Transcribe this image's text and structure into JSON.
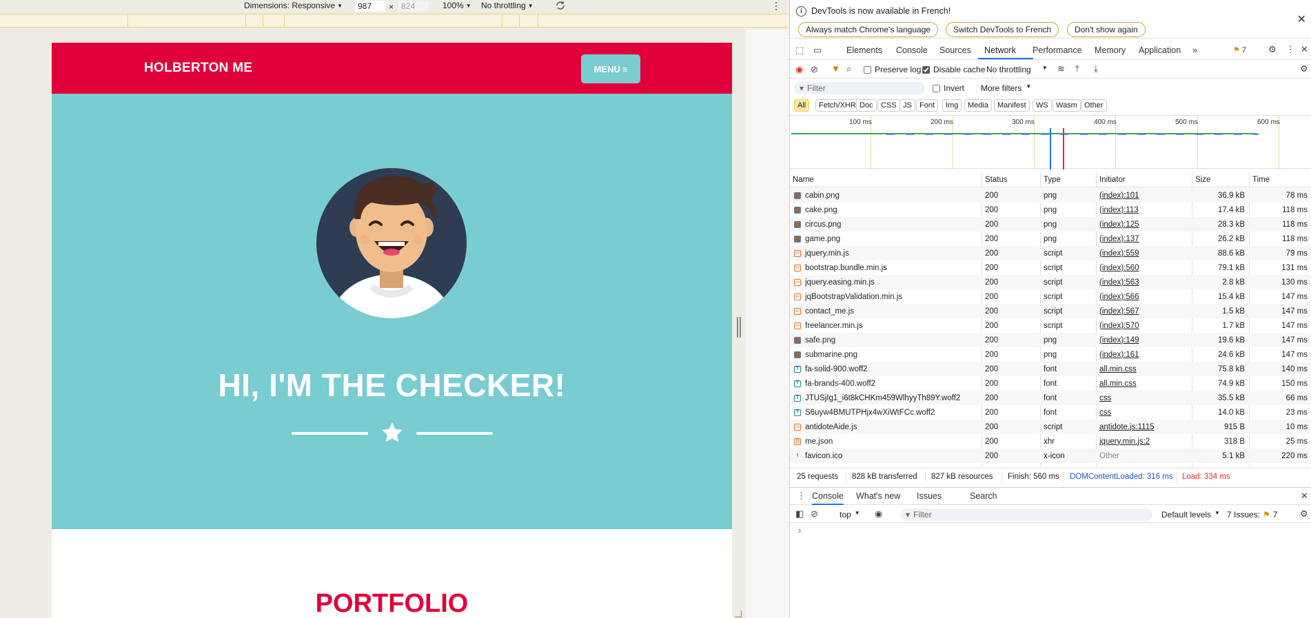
{
  "emulation_toolbar": {
    "dimensions_label": "Dimensions: Responsive",
    "width_value": "987",
    "times": "×",
    "height_value": "824",
    "zoom": "100%",
    "throttling": "No throttling"
  },
  "site": {
    "brand": "HOLBERTON ME",
    "menu_label": "MENU",
    "hero_title": "HI, I'M THE CHECKER!",
    "portfolio_title": "PORTFOLIO",
    "colors": {
      "primary": "#e2003b",
      "hero": "#79ccd0"
    }
  },
  "devtools": {
    "infobar": {
      "message": "DevTools is now available in French!",
      "btn_match": "Always match Chrome's language",
      "btn_switch": "Switch DevTools to French",
      "btn_dismiss": "Don't show again"
    },
    "tabs": [
      "Elements",
      "Console",
      "Sources",
      "Network",
      "Performance",
      "Memory",
      "Application"
    ],
    "issues_count": "7",
    "network_toolbar": {
      "preserve_log": "Preserve log",
      "disable_cache": "Disable cache",
      "throttling": "No throttling"
    },
    "filter": {
      "placeholder": "Filter",
      "invert": "Invert",
      "more_filters": "More filters"
    },
    "type_filters": [
      "All",
      "Fetch/XHR",
      "Doc",
      "CSS",
      "JS",
      "Font",
      "Img",
      "Media",
      "Manifest",
      "WS",
      "Wasm",
      "Other"
    ],
    "overview_ticks": [
      "100 ms",
      "200 ms",
      "300 ms",
      "400 ms",
      "500 ms",
      "600 ms"
    ],
    "columns": [
      "Name",
      "Status",
      "Type",
      "Initiator",
      "Size",
      "Time"
    ],
    "rows": [
      {
        "icon": "png",
        "name": "cabin.png",
        "status": "200",
        "type": "png",
        "initiator": "(index):101",
        "size": "36.9 kB",
        "time": "78 ms"
      },
      {
        "icon": "png",
        "name": "cake.png",
        "status": "200",
        "type": "png",
        "initiator": "(index):113",
        "size": "17.4 kB",
        "time": "118 ms"
      },
      {
        "icon": "png",
        "name": "circus.png",
        "status": "200",
        "type": "png",
        "initiator": "(index):125",
        "size": "28.3 kB",
        "time": "118 ms"
      },
      {
        "icon": "png",
        "name": "game.png",
        "status": "200",
        "type": "png",
        "initiator": "(index):137",
        "size": "26.2 kB",
        "time": "118 ms"
      },
      {
        "icon": "script",
        "name": "jquery.min.js",
        "status": "200",
        "type": "script",
        "initiator": "(index):559",
        "size": "88.6 kB",
        "time": "79 ms"
      },
      {
        "icon": "script",
        "name": "bootstrap.bundle.min.js",
        "status": "200",
        "type": "script",
        "initiator": "(index):560",
        "size": "79.1 kB",
        "time": "131 ms"
      },
      {
        "icon": "script",
        "name": "jquery.easing.min.js",
        "status": "200",
        "type": "script",
        "initiator": "(index):563",
        "size": "2.8 kB",
        "time": "130 ms"
      },
      {
        "icon": "script",
        "name": "jqBootstrapValidation.min.js",
        "status": "200",
        "type": "script",
        "initiator": "(index):566",
        "size": "15.4 kB",
        "time": "147 ms"
      },
      {
        "icon": "script",
        "name": "contact_me.js",
        "status": "200",
        "type": "script",
        "initiator": "(index):567",
        "size": "1.5 kB",
        "time": "147 ms"
      },
      {
        "icon": "script",
        "name": "freelancer.min.js",
        "status": "200",
        "type": "script",
        "initiator": "(index):570",
        "size": "1.7 kB",
        "time": "147 ms"
      },
      {
        "icon": "png",
        "name": "safe.png",
        "status": "200",
        "type": "png",
        "initiator": "(index):149",
        "size": "19.6 kB",
        "time": "147 ms"
      },
      {
        "icon": "png",
        "name": "submarine.png",
        "status": "200",
        "type": "png",
        "initiator": "(index):161",
        "size": "24.6 kB",
        "time": "147 ms"
      },
      {
        "icon": "font",
        "name": "fa-solid-900.woff2",
        "status": "200",
        "type": "font",
        "initiator": "all.min.css",
        "size": "75.8 kB",
        "time": "140 ms"
      },
      {
        "icon": "font",
        "name": "fa-brands-400.woff2",
        "status": "200",
        "type": "font",
        "initiator": "all.min.css",
        "size": "74.9 kB",
        "time": "150 ms"
      },
      {
        "icon": "font",
        "name": "JTUSjIg1_i6t8kCHKm459WlhyyTh89Y.woff2",
        "status": "200",
        "type": "font",
        "initiator": "css",
        "size": "35.5 kB",
        "time": "66 ms"
      },
      {
        "icon": "font",
        "name": "S6uyw4BMUTPHjx4wXiWtFCc.woff2",
        "status": "200",
        "type": "font",
        "initiator": "css",
        "size": "14.0 kB",
        "time": "23 ms"
      },
      {
        "icon": "script",
        "name": "antidoteAide.js",
        "status": "200",
        "type": "script",
        "initiator": "antidote.js:1115",
        "size": "915 B",
        "time": "10 ms"
      },
      {
        "icon": "xhr",
        "name": "me.json",
        "status": "200",
        "type": "xhr",
        "initiator": "jquery.min.js:2",
        "size": "318 B",
        "time": "25 ms"
      },
      {
        "icon": "ico",
        "name": "favicon.ico",
        "status": "200",
        "type": "x-icon",
        "initiator": "Other",
        "size": "5.1 kB",
        "time": "220 ms"
      }
    ],
    "summary": {
      "requests": "25 requests",
      "transferred": "828 kB transferred",
      "resources": "827 kB resources",
      "finish": "Finish: 560 ms",
      "dom_content_loaded": "DOMContentLoaded: 316 ms",
      "load": "Load: 334 ms"
    },
    "drawer_tabs": [
      "Console",
      "What's new",
      "Issues",
      "Search"
    ],
    "console_toolbar": {
      "context": "top",
      "filter_placeholder": "Filter",
      "levels": "Default levels",
      "issues": "7 Issues:",
      "issues_count": "7"
    },
    "console_prompt": "›"
  }
}
